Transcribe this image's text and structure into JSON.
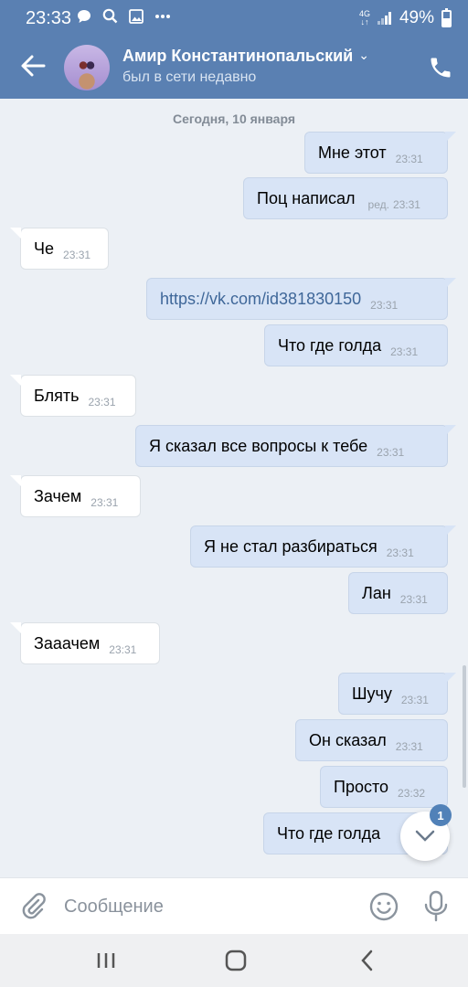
{
  "status_bar": {
    "time": "23:33",
    "icons": [
      "chat-bubble-icon",
      "search-icon",
      "image-icon",
      "more-dots-icon"
    ],
    "network": "4G",
    "battery": "49%",
    "battery_level": 0.49
  },
  "header": {
    "contact_name": "Амир Константинопальский",
    "status": "был в сети недавно"
  },
  "date_divider": "Сегодня, 10 января",
  "messages": [
    {
      "dir": "out",
      "text": "Мне этот",
      "time": "23:31"
    },
    {
      "dir": "out",
      "text": "Поц написал",
      "time": "23:31",
      "edited": "ред."
    },
    {
      "dir": "in",
      "text": "Че",
      "time": "23:31"
    },
    {
      "dir": "out",
      "text": "https://vk.com/id381830150",
      "time": "23:31",
      "is_link": true
    },
    {
      "dir": "out",
      "text": "Что где голда",
      "time": "23:31"
    },
    {
      "dir": "in",
      "text": "Блять",
      "time": "23:31"
    },
    {
      "dir": "out",
      "text": "Я сказал все вопросы к тебе",
      "time": "23:31"
    },
    {
      "dir": "in",
      "text": "Зачем",
      "time": "23:31"
    },
    {
      "dir": "out",
      "text": "Я не стал разбираться",
      "time": "23:31"
    },
    {
      "dir": "out",
      "text": "Лан",
      "time": "23:31"
    },
    {
      "dir": "in",
      "text": "Зааачем",
      "time": "23:31"
    },
    {
      "dir": "out",
      "text": "Шучу",
      "time": "23:31"
    },
    {
      "dir": "out",
      "text": "Он сказал",
      "time": "23:31"
    },
    {
      "dir": "out",
      "text": "Просто",
      "time": "23:32"
    },
    {
      "dir": "out",
      "text": "Что где голда",
      "time": ""
    }
  ],
  "scroll_down_badge": "1",
  "composer": {
    "placeholder": "Сообщение"
  },
  "colors": {
    "header": "#5a80b2",
    "outgoing_bubble": "#d8e4f6",
    "incoming_bubble": "#ffffff",
    "background": "#ecf0f5",
    "badge": "#5181b8"
  }
}
